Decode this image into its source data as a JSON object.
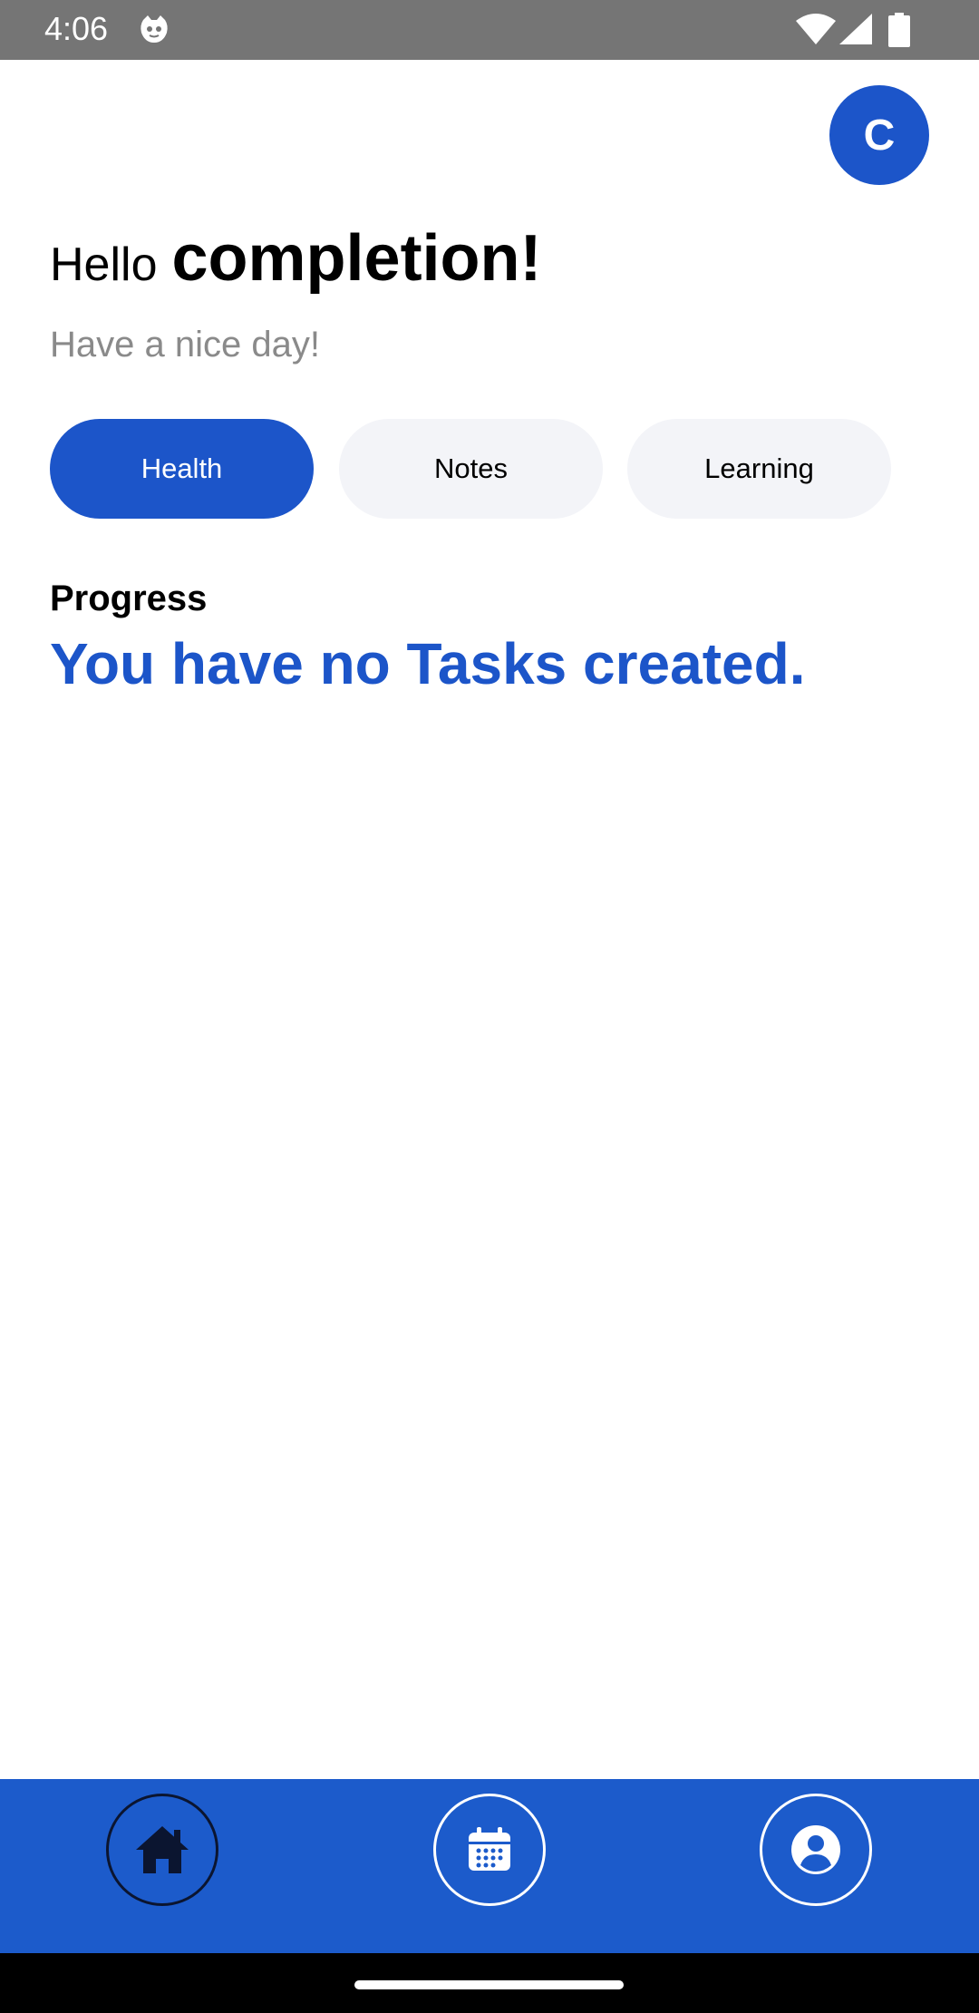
{
  "status_bar": {
    "time": "4:06",
    "app_icon": "cat-face-icon",
    "wifi_icon": "wifi-icon",
    "signal_icon": "cell-signal-icon",
    "battery_icon": "battery-icon"
  },
  "avatar": {
    "initial": "C"
  },
  "greeting": {
    "hello": "Hello",
    "name": "completion!",
    "subtitle": "Have a nice day!"
  },
  "categories": [
    {
      "label": "Health",
      "selected": true
    },
    {
      "label": "Notes",
      "selected": false
    },
    {
      "label": "Learning",
      "selected": false
    }
  ],
  "progress": {
    "title": "Progress",
    "empty_message": "You have no Tasks created."
  },
  "bottom_nav": [
    {
      "icon": "home-icon",
      "selected": true
    },
    {
      "icon": "calendar-icon",
      "selected": false
    },
    {
      "icon": "profile-icon",
      "selected": false
    }
  ],
  "colors": {
    "accent": "#1c55c9",
    "chip_inactive_bg": "#f3f4f8",
    "subtitle_text": "#8a8a8a",
    "status_bar_bg": "#757575"
  }
}
